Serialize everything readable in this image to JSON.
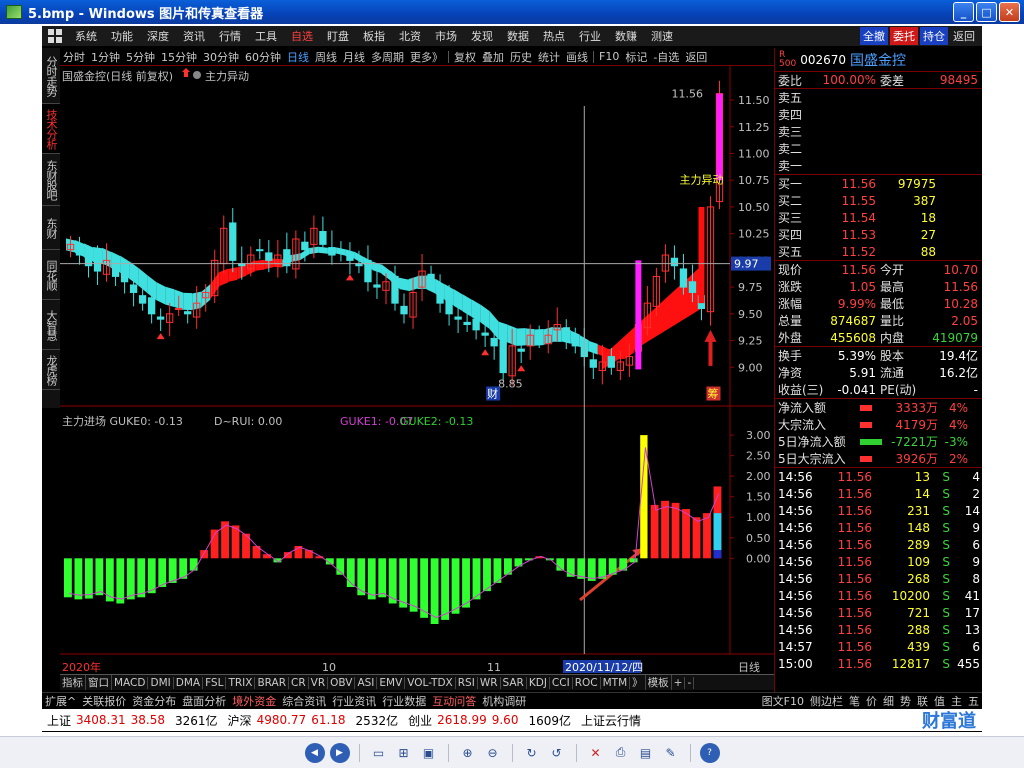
{
  "window": {
    "title": "5.bmp - Windows 图片和传真查看器",
    "btn_min": "_",
    "btn_max": "□",
    "btn_close": "✕"
  },
  "menu": {
    "items": [
      "系统",
      "功能",
      "深度",
      "资讯",
      "行情",
      "工具",
      "自选",
      "盯盘",
      "板指",
      "北资",
      "市场",
      "发现",
      "数据",
      "热点",
      "行业",
      "数赚",
      "测速"
    ],
    "active_index": 6,
    "right_buttons": [
      "全撤",
      "委托",
      "持仓",
      "返回"
    ]
  },
  "left_tabs": [
    "分时走势",
    "技术分析",
    "东财股吧",
    "东财",
    "同花顺",
    "大智慧",
    "龙虎榜"
  ],
  "left_tab_active": 1,
  "periods": [
    "分时",
    "1分钟",
    "5分钟",
    "15分钟",
    "30分钟",
    "60分钟",
    "日线",
    "周线",
    "月线",
    "多周期",
    "更多》",
    "复权",
    "叠加",
    "历史",
    "统计",
    "画线",
    "F10",
    "标记",
    "-自选",
    "返回"
  ],
  "period_active": 6,
  "chart": {
    "title": "国盛金控(日线 前复权)",
    "indicator_name": "主力异动",
    "label_main": "主力异动",
    "price_high_label": "11.56",
    "price_low_label": "8.85",
    "current_price_tag": "9.97",
    "badge_cai": "财",
    "badge_chou": "筹",
    "y_ticks": [
      "11.50",
      "11.25",
      "11.00",
      "10.75",
      "10.50",
      "10.25",
      "10.00",
      "9.75",
      "9.50",
      "9.25",
      "9.00"
    ],
    "sub_title": "主力进场 GUKE0: -0.13",
    "sub_items": [
      "D~RUI: 0.00",
      "GUKE1: -0.07",
      "GUKE2: -0.13"
    ],
    "sub_y_ticks": [
      "3.00",
      "2.50",
      "2.00",
      "1.50",
      "1.00",
      "0.50",
      "0.00"
    ],
    "x_labels": [
      "2020年",
      "10",
      "11",
      "2020/11/12/四"
    ],
    "x_right_label": "日线"
  },
  "chart_data": {
    "type": "candlestick",
    "title": "国盛金控(日线 前复权)",
    "ylim": [
      8.75,
      11.65
    ],
    "candles_close": [
      10.15,
      10.05,
      9.95,
      9.9,
      10.0,
      9.85,
      9.8,
      9.7,
      9.6,
      9.5,
      9.45,
      9.5,
      9.55,
      9.5,
      9.6,
      9.7,
      10.0,
      10.3,
      10.0,
      9.95,
      10.05,
      10.1,
      10.0,
      10.05,
      9.95,
      10.2,
      10.1,
      10.3,
      10.15,
      10.05,
      10.1,
      10.0,
      9.95,
      9.8,
      9.75,
      9.8,
      9.6,
      9.5,
      9.7,
      9.9,
      9.8,
      9.6,
      9.5,
      9.45,
      9.4,
      9.35,
      9.3,
      9.2,
      8.95,
      9.2,
      9.15,
      9.3,
      9.25,
      9.3,
      9.4,
      9.3,
      9.2,
      9.1,
      9.0,
      9.05,
      9.0,
      9.05,
      9.1,
      9.4,
      9.6,
      9.85,
      10.05,
      9.95,
      9.75,
      9.7,
      9.55,
      10.5,
      11.56
    ],
    "sub_values": [
      -0.95,
      -1.0,
      -0.98,
      -0.9,
      -1.05,
      -1.1,
      -1.0,
      -0.95,
      -0.85,
      -0.7,
      -0.6,
      -0.5,
      -0.3,
      0.2,
      0.7,
      0.9,
      0.8,
      0.6,
      0.3,
      0.1,
      -0.1,
      0.15,
      0.3,
      0.2,
      0.05,
      -0.15,
      -0.4,
      -0.7,
      -0.9,
      -1.0,
      -0.95,
      -1.1,
      -1.2,
      -1.3,
      -1.45,
      -1.6,
      -1.5,
      -1.35,
      -1.2,
      -1.0,
      -0.8,
      -0.6,
      -0.4,
      -0.2,
      -0.05,
      0.05,
      -0.05,
      -0.3,
      -0.45,
      -0.5,
      -0.55,
      -0.5,
      -0.4,
      -0.3,
      -0.1,
      3.0,
      1.3,
      1.4,
      1.35,
      1.2,
      1.0,
      1.1,
      1.75
    ],
    "sub_ylim": [
      -1.6,
      3.1
    ]
  },
  "quote": {
    "code": "002670",
    "name": "国盛金控",
    "weibi_label": "委比",
    "weibi": "100.00%",
    "weicha_label": "委差",
    "weicha": "98495",
    "sell_labels": [
      "卖五",
      "卖四",
      "卖三",
      "卖二",
      "卖一"
    ],
    "buy": [
      {
        "label": "买一",
        "price": "11.56",
        "vol": "97975"
      },
      {
        "label": "买二",
        "price": "11.55",
        "vol": "387"
      },
      {
        "label": "买三",
        "price": "11.54",
        "vol": "18"
      },
      {
        "label": "买四",
        "price": "11.53",
        "vol": "27"
      },
      {
        "label": "买五",
        "price": "11.52",
        "vol": "88"
      }
    ],
    "stats": [
      {
        "l1": "现价",
        "v1": "11.56",
        "l2": "今开",
        "v2": "10.70"
      },
      {
        "l1": "涨跌",
        "v1": "1.05",
        "l2": "最高",
        "v2": "11.56"
      },
      {
        "l1": "涨幅",
        "v1": "9.99%",
        "l2": "最低",
        "v2": "10.28"
      },
      {
        "l1": "总量",
        "v1": "874687",
        "l2": "量比",
        "v2": "2.05"
      },
      {
        "l1": "外盘",
        "v1": "455608",
        "l2": "内盘",
        "v2": "419079"
      }
    ],
    "stats2": [
      {
        "l1": "换手",
        "v1": "5.39%",
        "l2": "股本",
        "v2": "19.4亿"
      },
      {
        "l1": "净资",
        "v1": "5.91",
        "l2": "流通",
        "v2": "16.2亿"
      },
      {
        "l1": "收益(三)",
        "v1": "-0.041",
        "l2": "PE(动)",
        "v2": "-"
      }
    ],
    "flows": [
      {
        "label": "净流入额",
        "value": "3333万",
        "pct": "4%",
        "color": "red"
      },
      {
        "label": "大宗流入",
        "value": "4179万",
        "pct": "4%",
        "color": "red"
      },
      {
        "label": "5日净流入额",
        "value": "-7221万",
        "pct": "-3%",
        "color": "green"
      },
      {
        "label": "5日大宗流入",
        "value": "3926万",
        "pct": "2%",
        "color": "red"
      }
    ],
    "ticks": [
      {
        "t": "14:56",
        "p": "11.56",
        "v": "13",
        "s": "S",
        "n": "4"
      },
      {
        "t": "14:56",
        "p": "11.56",
        "v": "14",
        "s": "S",
        "n": "2"
      },
      {
        "t": "14:56",
        "p": "11.56",
        "v": "231",
        "s": "S",
        "n": "14"
      },
      {
        "t": "14:56",
        "p": "11.56",
        "v": "148",
        "s": "S",
        "n": "9"
      },
      {
        "t": "14:56",
        "p": "11.56",
        "v": "289",
        "s": "S",
        "n": "6"
      },
      {
        "t": "14:56",
        "p": "11.56",
        "v": "109",
        "s": "S",
        "n": "9"
      },
      {
        "t": "14:56",
        "p": "11.56",
        "v": "268",
        "s": "S",
        "n": "8"
      },
      {
        "t": "14:56",
        "p": "11.56",
        "v": "10200",
        "s": "S",
        "n": "41"
      },
      {
        "t": "14:56",
        "p": "11.56",
        "v": "721",
        "s": "S",
        "n": "17"
      },
      {
        "t": "14:56",
        "p": "11.56",
        "v": "288",
        "s": "S",
        "n": "13"
      },
      {
        "t": "14:57",
        "p": "11.56",
        "v": "439",
        "s": "S",
        "n": "6"
      },
      {
        "t": "15:00",
        "p": "11.56",
        "v": "12817",
        "s": "S",
        "n": "455"
      }
    ]
  },
  "bottom_tabs": [
    "指标",
    "窗口",
    "MACD",
    "DMI",
    "DMA",
    "FSL",
    "TRIX",
    "BRAR",
    "CR",
    "VR",
    "OBV",
    "ASI",
    "EMV",
    "VOL-TDX",
    "RSI",
    "WR",
    "SAR",
    "KDJ",
    "CCI",
    "ROC",
    "MTM",
    "》",
    "模板",
    "+",
    "-"
  ],
  "ext_bar": {
    "left": [
      "扩展^",
      "关联报价",
      "资金分布",
      "盘面分析",
      "境外资金",
      "综合资讯",
      "行业资讯",
      "行业数据",
      "互动问答",
      "机构调研"
    ],
    "right": [
      "图文F10",
      "侧边栏",
      "笔",
      "价",
      "细",
      "势",
      "联",
      "值",
      "主",
      "五"
    ]
  },
  "ticker": {
    "items": [
      {
        "name": "上证",
        "val": "3408.31",
        "chg": "38.58",
        "amt": "3261亿"
      },
      {
        "name": "沪深",
        "val": "4980.77",
        "chg": "61.18",
        "amt": "2532亿"
      },
      {
        "name": "创业",
        "val": "2618.99",
        "chg": "9.60",
        "amt": "1609亿"
      }
    ],
    "right_text": "上证云行情",
    "watermark": "财富道"
  },
  "viewer_bar_icons": [
    "prev-icon",
    "next-icon",
    "best-fit-icon",
    "actual-size-icon",
    "slideshow-icon",
    "zoom-in-icon",
    "zoom-out-icon",
    "rotate-cw-icon",
    "rotate-ccw-icon",
    "delete-icon",
    "print-icon",
    "save-icon",
    "edit-icon",
    "help-icon"
  ]
}
